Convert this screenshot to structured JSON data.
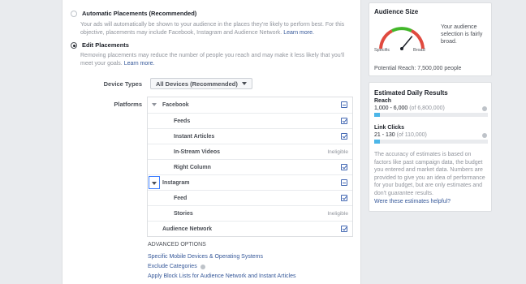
{
  "placements": {
    "automatic": {
      "title": "Automatic Placements (Recommended)",
      "desc": "Your ads will automatically be shown to your audience in the places they're likely to perform best. For this objective, placements may include Facebook, Instagram and Audience Network.",
      "link": "Learn more."
    },
    "edit": {
      "title": "Edit Placements",
      "desc": "Removing placements may reduce the number of people you reach and may make it less likely that you'll meet your goals.",
      "link": "Learn more."
    },
    "device_types_label": "Device Types",
    "device_types_value": "All Devices (Recommended)",
    "platforms_label": "Platforms",
    "rows": [
      {
        "name": "Facebook",
        "kind": "group",
        "control": "minus"
      },
      {
        "name": "Feeds",
        "kind": "sub",
        "control": "check"
      },
      {
        "name": "Instant Articles",
        "kind": "sub",
        "control": "check"
      },
      {
        "name": "In-Stream Videos",
        "kind": "sub",
        "control": "Ineligible"
      },
      {
        "name": "Right Column",
        "kind": "sub",
        "control": "check"
      },
      {
        "name": "Instagram",
        "kind": "group",
        "control": "minus"
      },
      {
        "name": "Feed",
        "kind": "sub",
        "control": "check"
      },
      {
        "name": "Stories",
        "kind": "sub",
        "control": "Ineligible"
      },
      {
        "name": "Audience Network",
        "kind": "group",
        "control": "check"
      }
    ],
    "advanced_heading": "ADVANCED OPTIONS",
    "advanced_links": [
      "Specific Mobile Devices & Operating Systems",
      "Exclude Categories",
      "Apply Block Lists for Audience Network and Instant Articles"
    ]
  },
  "audience_size": {
    "title": "Audience Size",
    "gauge_left": "Specific",
    "gauge_right": "Broad",
    "gauge_level": 0.72,
    "note": "Your audience selection is fairly broad.",
    "potential_reach": "Potential Reach: 7,500,000 people"
  },
  "estimates": {
    "title": "Estimated Daily Results",
    "reach_label": "Reach",
    "reach_range": "1,000 - 6,000",
    "reach_of": "(of 6,800,000)",
    "reach_fill": 0.05,
    "clicks_label": "Link Clicks",
    "clicks_range": "21 - 130",
    "clicks_of": "(of 110,000)",
    "clicks_fill": 0.05,
    "disclaimer": "The accuracy of estimates is based on factors like past campaign data, the budget you entered and market data. Numbers are provided to give you an idea of performance for your budget, but are only estimates and don't guarantee results.",
    "helpful_link": "Were these estimates helpful?"
  },
  "colors": {
    "link": "#365899",
    "accent_blue": "#4267b2",
    "bar_fill": "#4cb6e8",
    "gauge_green": "#42b72a",
    "gauge_red": "#e04a3f"
  }
}
